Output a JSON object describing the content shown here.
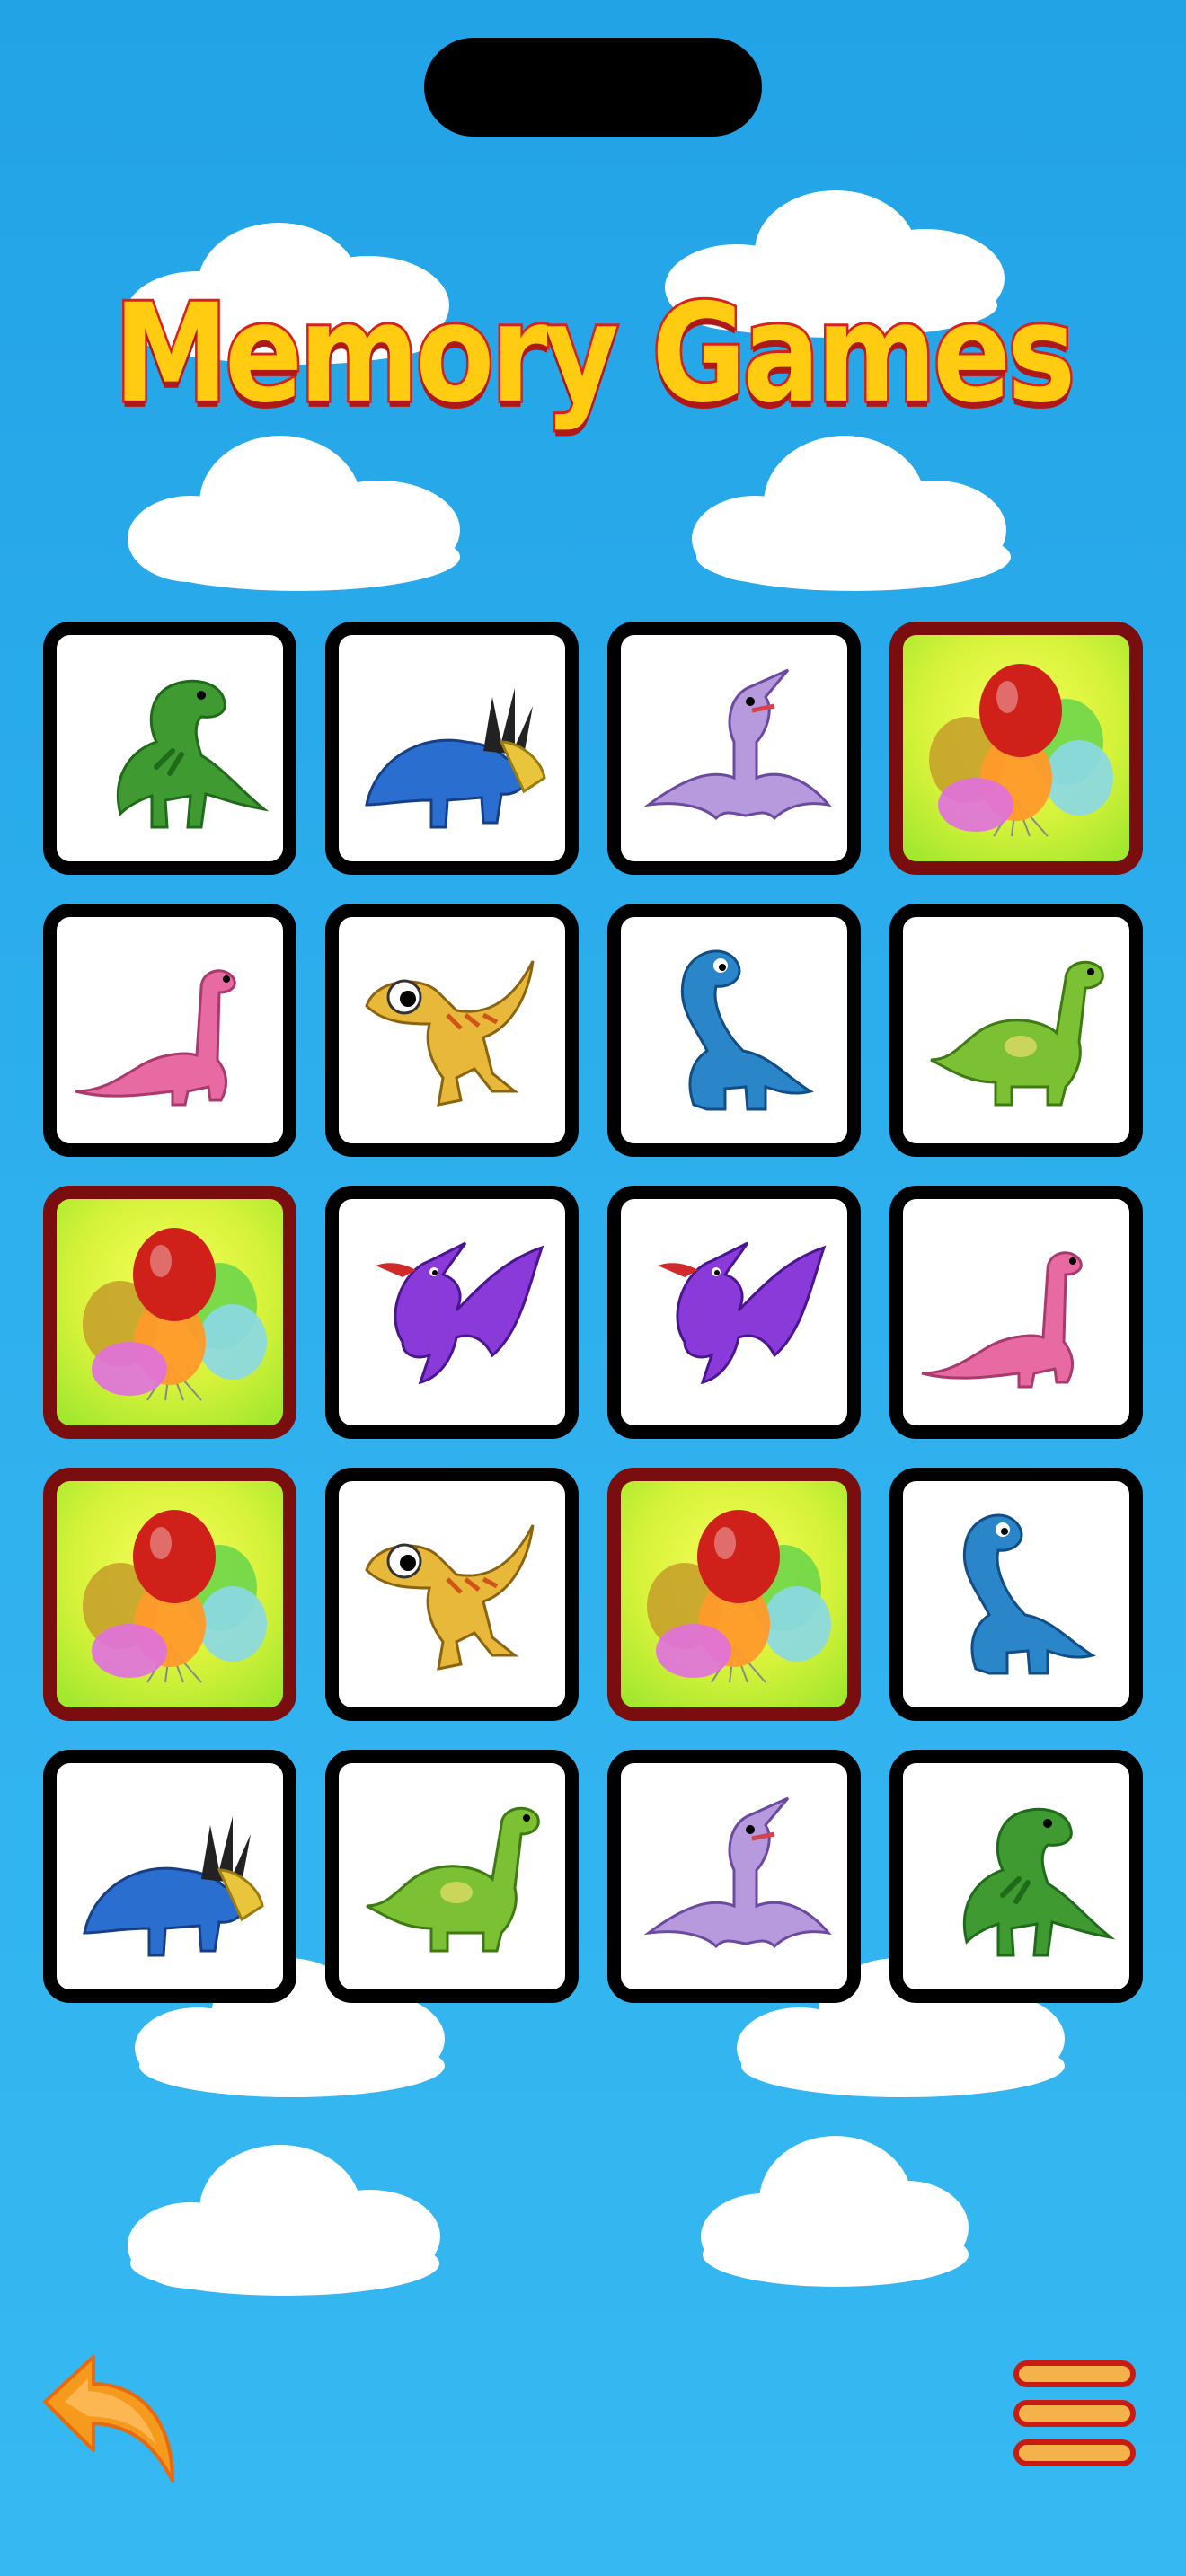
{
  "game": {
    "title": "Memory Games",
    "rows": 5,
    "columns": 4,
    "cards": [
      {
        "icon": "trex-icon",
        "state": "face-up"
      },
      {
        "icon": "styracosaurus-icon",
        "state": "face-up"
      },
      {
        "icon": "pterodactyl-icon",
        "state": "face-up"
      },
      {
        "icon": "balloons-card-back-icon",
        "state": "face-down"
      },
      {
        "icon": "pink-brontosaurus-icon",
        "state": "face-up"
      },
      {
        "icon": "raptor-icon",
        "state": "face-up"
      },
      {
        "icon": "blue-brontosaurus-icon",
        "state": "face-up"
      },
      {
        "icon": "green-brontosaurus-icon",
        "state": "face-up"
      },
      {
        "icon": "balloons-card-back-icon",
        "state": "face-down"
      },
      {
        "icon": "purple-dragon-icon",
        "state": "face-up"
      },
      {
        "icon": "purple-dragon-icon",
        "state": "face-up"
      },
      {
        "icon": "pink-brontosaurus-icon",
        "state": "face-up"
      },
      {
        "icon": "balloons-card-back-icon",
        "state": "face-down"
      },
      {
        "icon": "raptor-icon",
        "state": "face-up"
      },
      {
        "icon": "balloons-card-back-icon",
        "state": "face-down"
      },
      {
        "icon": "blue-brontosaurus-icon",
        "state": "face-up"
      },
      {
        "icon": "styracosaurus-icon",
        "state": "face-up"
      },
      {
        "icon": "green-brontosaurus-icon",
        "state": "face-up"
      },
      {
        "icon": "pterodactyl-icon",
        "state": "face-up"
      },
      {
        "icon": "trex-icon",
        "state": "face-up"
      }
    ]
  },
  "controls": {
    "back_icon": "back-arrow-icon",
    "menu_icon": "hamburger-menu-icon"
  },
  "colors": {
    "sky": "#2aaaea",
    "title_fill": "#ffcc11",
    "title_stroke": "#d9211c",
    "card_border": "#000000",
    "card_back_border": "#7a0d0d",
    "card_back_fill": "#d6f23a",
    "back_arrow": "#f59a1c",
    "menu_fill": "#f6b24a",
    "menu_stroke": "#c81c12"
  }
}
